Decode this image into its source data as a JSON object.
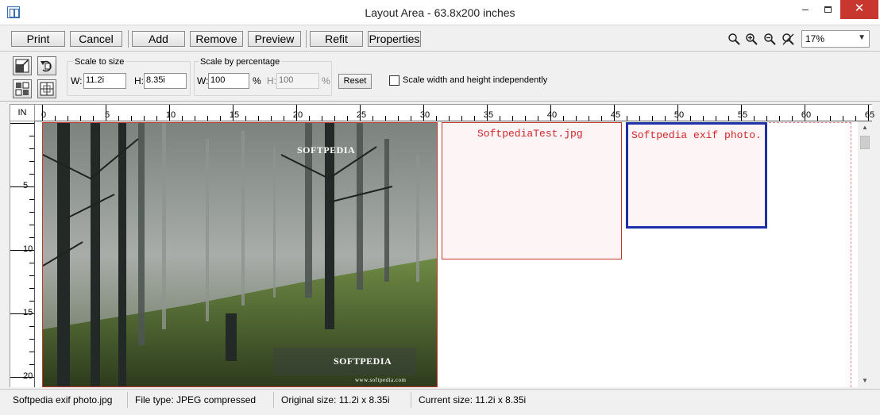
{
  "window": {
    "title": "Layout Area - 63.8x200 inches",
    "minimize": "–",
    "close": "✕"
  },
  "toolbar": {
    "print": "Print",
    "cancel": "Cancel",
    "add": "Add",
    "remove": "Remove",
    "preview": "Preview",
    "refit": "Refit",
    "properties": "Properties",
    "zoom_value": "17%"
  },
  "panel": {
    "scale_to_size": {
      "legend": "Scale to size",
      "w_label": "W:",
      "w_value": "11.2i",
      "h_label": "H:",
      "h_value": "8.35i"
    },
    "scale_by_pct": {
      "legend": "Scale by percentage",
      "w_label": "W:",
      "w_value": "100",
      "w_unit": "%",
      "h_label": "H:",
      "h_value": "100",
      "h_unit": "%"
    },
    "reset": "Reset",
    "independent_label": "Scale width and height independently"
  },
  "ruler": {
    "unit": "IN",
    "h_labels": [
      "0",
      "5",
      "10",
      "15",
      "20",
      "25",
      "30",
      "35",
      "40",
      "45",
      "50",
      "55",
      "60",
      "65"
    ],
    "v_labels": [
      "5",
      "10",
      "15",
      "20"
    ]
  },
  "canvas": {
    "photo_brand_top": "SOFTPEDIA",
    "photo_brand_bottom": "SOFTPEDIA",
    "photo_url": "www.softpedia.com",
    "box1_label": "SoftpediaTest.jpg",
    "box2_label": "Softpedia exif photo."
  },
  "status": {
    "file": "Softpedia exif photo.jpg",
    "type": "File type: JPEG compressed",
    "original": "Original size: 11.2i x 8.35i",
    "current": "Current size: 11.2i x 8.35i"
  },
  "colors": {
    "accent_blue": "#1f2fa8",
    "item_red": "#c0392b",
    "close_red": "#c7372f"
  }
}
